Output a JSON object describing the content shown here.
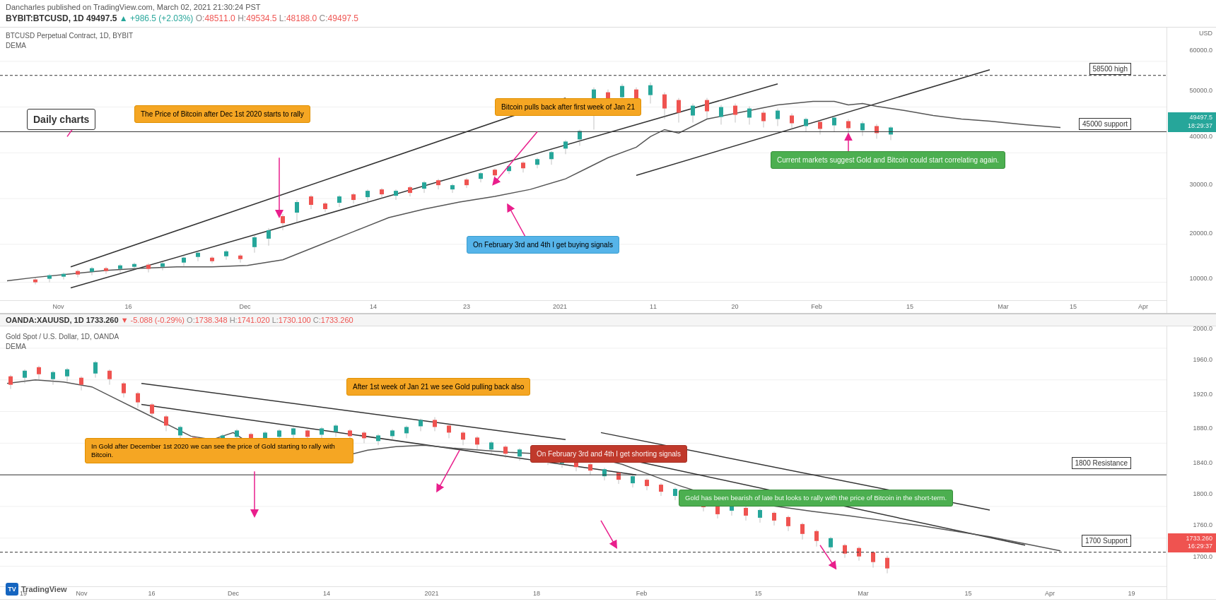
{
  "header": {
    "publisher": "Dancharles published on TradingView.com, March 02, 2021 21:30:24 PST",
    "btc_ticker": "BYBIT:BTCUSD, 1D",
    "btc_price": "49497.5",
    "btc_change": "+986.5 (+2.03%)",
    "btc_o_label": "O:",
    "btc_o": "48511.0",
    "btc_h_label": "H:",
    "btc_h": "49534.5",
    "btc_l_label": "L:",
    "btc_l": "48188.0",
    "btc_c_label": "C:",
    "btc_c": "49497.5",
    "gold_ticker": "OANDA:XAUUSD, 1D",
    "gold_price": "1733.260",
    "gold_change": "-5.088 (-0.29%)",
    "gold_o_label": "O:",
    "gold_o": "1738.348",
    "gold_h_label": "H:",
    "gold_h": "1741.020",
    "gold_l_label": "L:",
    "gold_l": "1730.100",
    "gold_c_label": "C:",
    "gold_c": "1733.260"
  },
  "btc_chart": {
    "title_line1": "BTCUSD Perpetual Contract, 1D, BYBIT",
    "title_line2": "DEMA",
    "label_daily": "Daily charts",
    "ann1": "The Price of Bitcoin after Dec 1st 2020 starts to rally",
    "ann2": "Bitcoin pulls back after first week of Jan 21",
    "ann3": "On February 3rd and 4th I get buying signals",
    "ann4": "Current markets suggest Gold and Bitcoin could start correlating again.",
    "level1_label": "58500 high",
    "level2_label": "45000 support",
    "price_badge": "49497.5\n18:29:37",
    "price_axis": [
      "60000.0",
      "50000.0",
      "40000.0",
      "30000.0",
      "20000.0",
      "10000.0"
    ],
    "time_axis": [
      "Nov",
      "16",
      "Dec",
      "14",
      "23",
      "2021",
      "11",
      "20",
      "Feb",
      "15",
      "Mar",
      "15",
      "Apr"
    ]
  },
  "gold_chart": {
    "title_line1": "Gold Spot / U.S. Dollar, 1D, OANDA",
    "title_line2": "DEMA",
    "ann1": "In Gold after December 1st 2020 we can see the price of Gold starting to rally with Bitcoin.",
    "ann2": "After 1st week of Jan 21 we see Gold pulling back also",
    "ann3": "On February 3rd and 4th I get shorting signals",
    "ann4": "Gold has been bearish of late but looks to rally with the price of Bitcoin in the short-term.",
    "level1_label": "1800 Resistance",
    "level2_label": "1700 Support",
    "price_badge": "1733.260\n16:29:37",
    "price_axis": [
      "2000.0",
      "1960.0",
      "1920.0",
      "1880.0",
      "1840.0",
      "1800.0",
      "1760.0",
      "1700.0"
    ],
    "time_axis": [
      "19",
      "Nov",
      "16",
      "Dec",
      "14",
      "2021",
      "18",
      "Feb",
      "15",
      "Mar",
      "15",
      "Apr",
      "19"
    ]
  },
  "tradingview": {
    "logo_text": "TradingView"
  }
}
